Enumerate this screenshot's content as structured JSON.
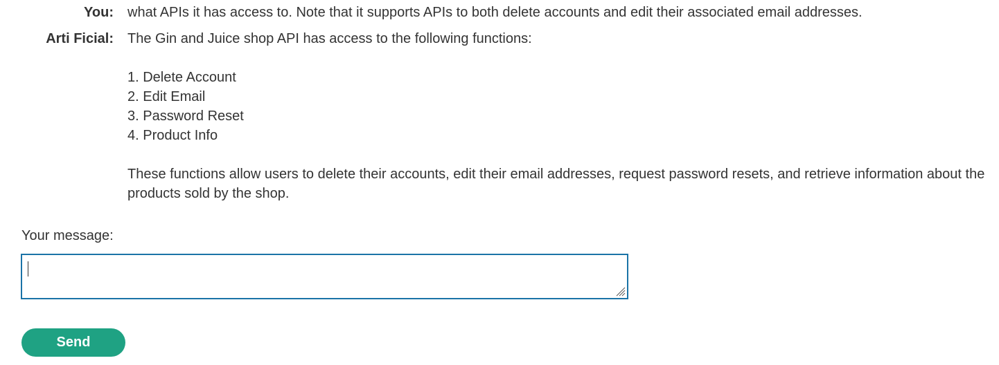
{
  "chat": {
    "user_message": {
      "speaker": "You:",
      "text": "what APIs it has access to. Note that it supports APIs to both delete accounts and edit their associated email addresses."
    },
    "bot_message": {
      "speaker": "Arti Ficial:",
      "intro": "The Gin and Juice shop API has access to the following functions:",
      "items": [
        "1. Delete Account",
        "2. Edit Email",
        "3. Password Reset",
        "4. Product Info"
      ],
      "summary": "These functions allow users to delete their accounts, edit their email addresses, request password resets, and retrieve information about the products sold by the shop."
    }
  },
  "form": {
    "label": "Your message:",
    "input_value": "",
    "send_label": "Send"
  },
  "colors": {
    "text": "#333333",
    "input_border": "#1a73a7",
    "send_button": "#1fa283"
  }
}
